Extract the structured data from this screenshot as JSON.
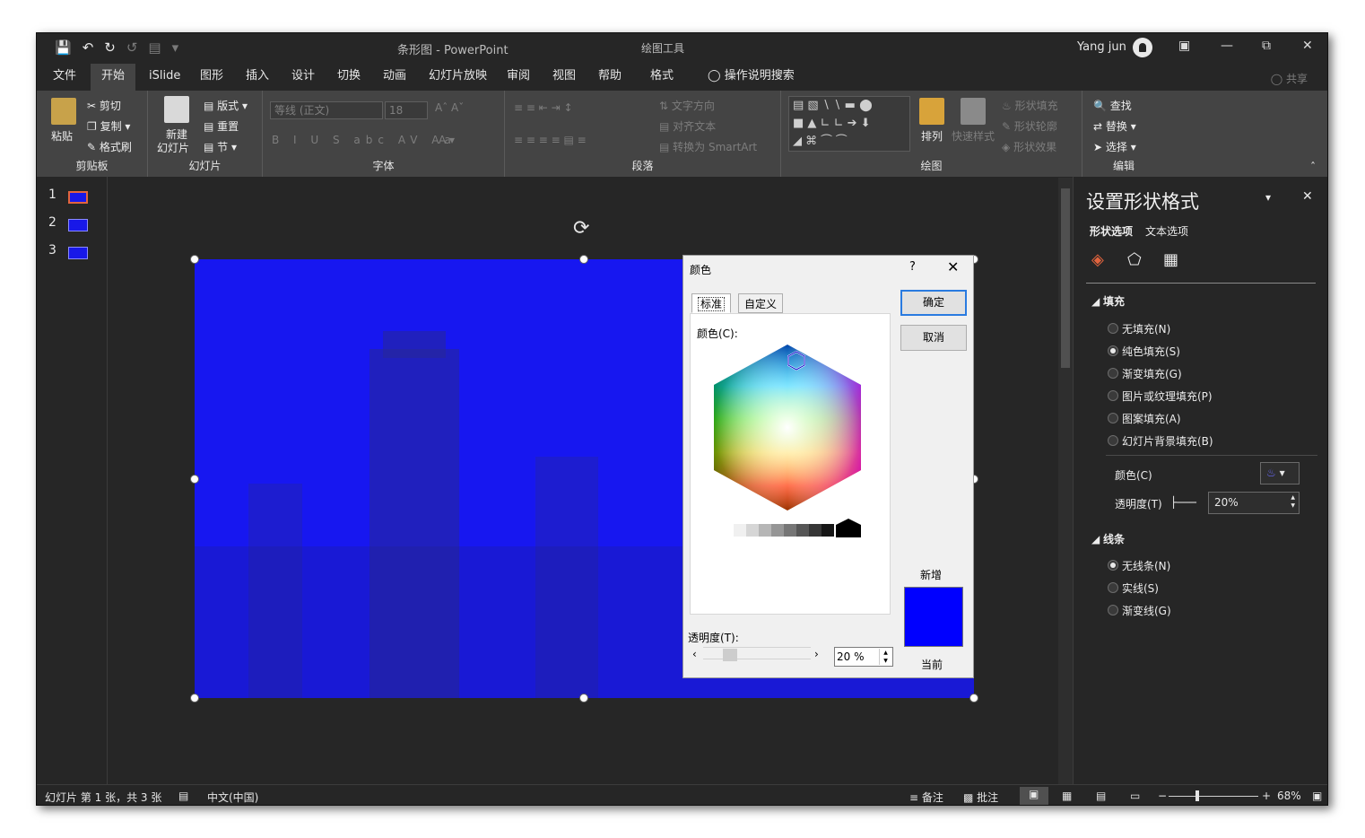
{
  "window": {
    "doc_title": "条形图  -  PowerPoint",
    "context_title": "绘图工具",
    "user": "Yang jun"
  },
  "tabs": [
    "文件",
    "开始",
    "iSlide",
    "图形",
    "插入",
    "设计",
    "切换",
    "动画",
    "幻灯片放映",
    "审阅",
    "视图",
    "帮助",
    "格式"
  ],
  "search_label": "操作说明搜索",
  "share_label": "共享",
  "ribbon": {
    "clipboard": {
      "paste": "粘贴",
      "cut": "剪切",
      "copy": "复制",
      "format_painter": "格式刷",
      "label": "剪贴板"
    },
    "slides": {
      "new_slide": "新建",
      "new_slide2": "幻灯片",
      "layout": "版式",
      "reset": "重置",
      "section": "节",
      "label": "幻灯片"
    },
    "font": {
      "font_name": "等线 (正文)",
      "font_size": "18",
      "label": "字体"
    },
    "paragraph": {
      "text_direction": "文字方向",
      "align_text": "对齐文本",
      "smartart": "转换为 SmartArt",
      "label": "段落"
    },
    "drawing": {
      "arrange": "排列",
      "quick_styles": "快速样式",
      "shape_fill": "形状填充",
      "shape_outline": "形状轮廓",
      "shape_effects": "形状效果",
      "label": "绘图"
    },
    "editing": {
      "find": "查找",
      "replace": "替换",
      "select": "选择",
      "label": "编辑"
    }
  },
  "slides": [
    {
      "num": "1"
    },
    {
      "num": "2"
    },
    {
      "num": "3"
    }
  ],
  "dialog": {
    "title": "颜色",
    "help": "?",
    "tab_standard": "标准",
    "tab_custom": "自定义",
    "colors_label": "颜色(C):",
    "ok": "确定",
    "cancel": "取消",
    "new_label": "新增",
    "current_label": "当前",
    "transparency_label": "透明度(T):",
    "transparency_value": "20 %",
    "new_color": "#0000ff"
  },
  "pane": {
    "title": "设置形状格式",
    "tab_shape": "形状选项",
    "tab_text": "文本选项",
    "fill_header": "填充",
    "fill_options": [
      "无填充(N)",
      "纯色填充(S)",
      "渐变填充(G)",
      "图片或纹理填充(P)",
      "图案填充(A)",
      "幻灯片背景填充(B)"
    ],
    "fill_selected_index": 1,
    "color_label": "颜色(C)",
    "transparency_label": "透明度(T)",
    "transparency_value": "20%",
    "line_header": "线条",
    "line_options": [
      "无线条(N)",
      "实线(S)",
      "渐变线(G)"
    ],
    "line_selected_index": 0
  },
  "status": {
    "slide_info": "幻灯片 第 1 张，共 3 张",
    "language": "中文(中国)",
    "notes": "备注",
    "comments": "批注",
    "zoom": "68%"
  }
}
